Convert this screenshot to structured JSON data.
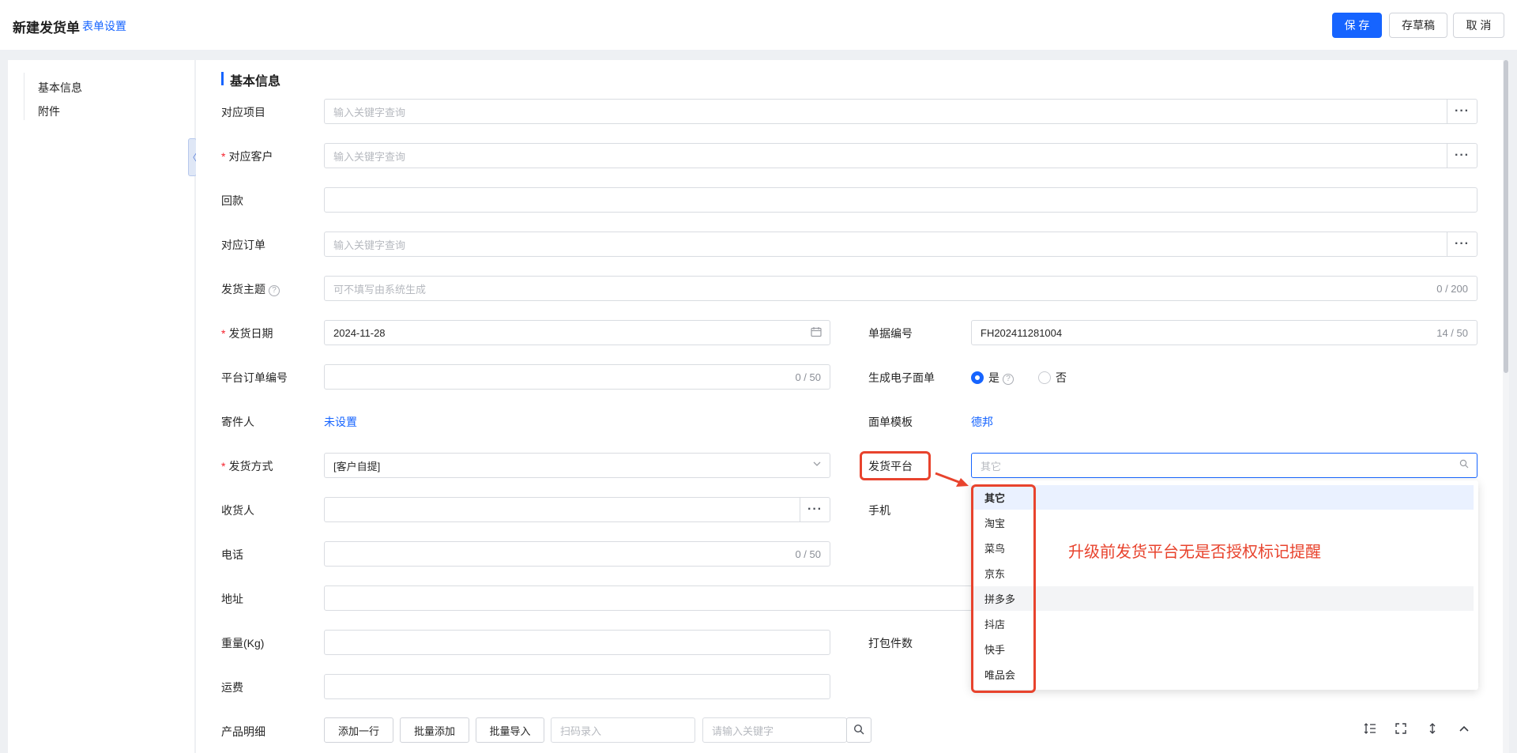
{
  "header": {
    "title": "新建发货单",
    "form_settings": "表单设置",
    "save": "保 存",
    "draft": "存草稿",
    "cancel": "取 消"
  },
  "sidebar": {
    "items": [
      {
        "label": "基本信息"
      },
      {
        "label": "附件"
      }
    ],
    "collapse_glyph": "〈"
  },
  "section": {
    "title": "基本信息"
  },
  "form": {
    "project": {
      "label": "对应项目",
      "placeholder": "输入关键字查询"
    },
    "customer": {
      "label": "对应客户",
      "required_mark": "*",
      "placeholder": "输入关键字查询"
    },
    "payment": {
      "label": "回款",
      "value": ""
    },
    "order": {
      "label": "对应订单",
      "placeholder": "输入关键字查询"
    },
    "subject": {
      "label": "发货主题",
      "help": "?",
      "placeholder": "可不填写由系统生成",
      "counter": "0 / 200"
    },
    "ship_date": {
      "label": "发货日期",
      "required_mark": "*",
      "value": "2024-11-28"
    },
    "doc_no": {
      "label": "单据编号",
      "value": "FH202411281004",
      "counter": "14 / 50"
    },
    "platform_order_no": {
      "label": "平台订单编号",
      "counter": "0 / 50"
    },
    "e_waybill": {
      "label": "生成电子面单",
      "yes": "是",
      "no": "否",
      "help": "?",
      "selected": "是"
    },
    "sender": {
      "label": "寄件人",
      "value": "未设置"
    },
    "waybill_template": {
      "label": "面单模板",
      "value": "德邦"
    },
    "ship_method": {
      "label": "发货方式",
      "required_mark": "*",
      "value": "[客户自提]"
    },
    "ship_platform": {
      "label": "发货平台",
      "placeholder": "其它"
    },
    "receiver": {
      "label": "收货人"
    },
    "mobile": {
      "label": "手机"
    },
    "phone": {
      "label": "电话",
      "counter": "0 / 50"
    },
    "address": {
      "label": "地址"
    },
    "weight": {
      "label": "重量(Kg)"
    },
    "package_count": {
      "label": "打包件数"
    },
    "freight": {
      "label": "运费"
    }
  },
  "platform_options": [
    "其它",
    "淘宝",
    "菜鸟",
    "京东",
    "拼多多",
    "抖店",
    "快手",
    "唯品会"
  ],
  "platform_selected": "其它",
  "platform_hovered": "拼多多",
  "annotation": "升级前发货平台无是否授权标记提醒",
  "products": {
    "label": "产品明细",
    "add_row": "添加一行",
    "batch_add": "批量添加",
    "batch_import": "批量导入",
    "scan_placeholder": "扫码录入",
    "keyword_placeholder": "请输入关键字"
  },
  "colors": {
    "primary": "#1664ff",
    "annotation_red": "#e8432d",
    "required_red": "#f5222d"
  }
}
